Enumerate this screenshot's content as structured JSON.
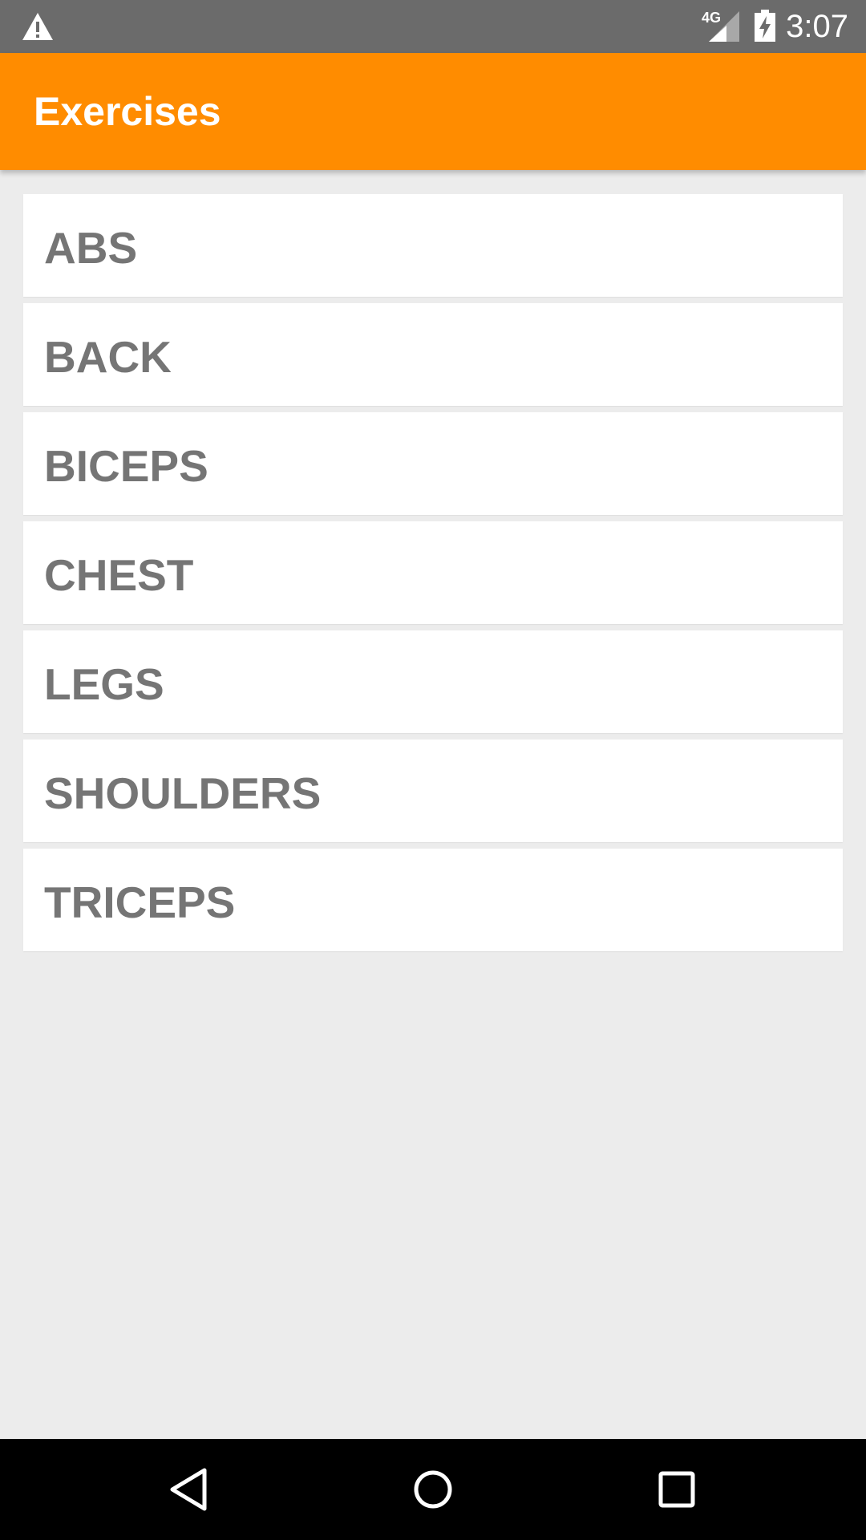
{
  "status_bar": {
    "left_icon": "warning-icon",
    "network_type": "4G",
    "signal_icon": "cell-signal-icon",
    "battery_icon": "battery-charging-icon",
    "time": "3:07"
  },
  "app_bar": {
    "title": "Exercises",
    "color": "#ff8c00"
  },
  "exercise_list": {
    "items": [
      {
        "label": "ABS"
      },
      {
        "label": "BACK"
      },
      {
        "label": "BICEPS"
      },
      {
        "label": "CHEST"
      },
      {
        "label": "LEGS"
      },
      {
        "label": "SHOULDERS"
      },
      {
        "label": "TRICEPS"
      }
    ]
  },
  "nav_bar": {
    "back_icon": "back-triangle-icon",
    "home_icon": "home-circle-icon",
    "recents_icon": "recents-square-icon"
  }
}
